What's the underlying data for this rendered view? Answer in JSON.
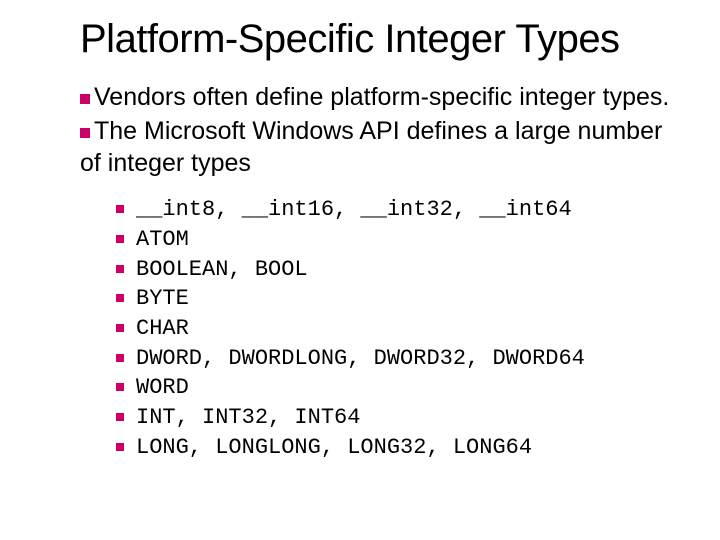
{
  "title": "Platform-Specific Integer Types",
  "main_points": [
    "Vendors often define platform-specific integer types.",
    "The Microsoft Windows API defines a large number of integer types"
  ],
  "sub_points": [
    "__int8, __int16, __int32, __int64",
    "ATOM",
    "BOOLEAN, BOOL",
    "BYTE",
    "CHAR",
    "DWORD, DWORDLONG, DWORD32, DWORD64",
    "WORD",
    "INT, INT32, INT64",
    "LONG, LONGLONG, LONG32, LONG64"
  ]
}
